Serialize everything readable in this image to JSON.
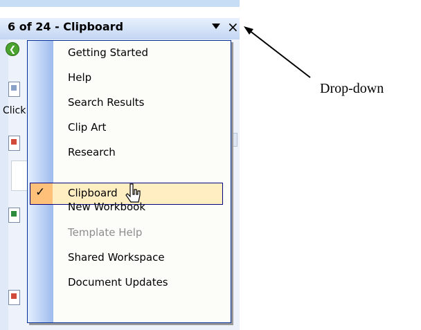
{
  "pane": {
    "title": "6 of 24 - Clipboard",
    "side_text": "Click"
  },
  "menu": {
    "items": [
      {
        "label": "Getting Started",
        "state": "normal"
      },
      {
        "label": "Help",
        "state": "normal"
      },
      {
        "label": "Search Results",
        "state": "normal"
      },
      {
        "label": "Clip Art",
        "state": "normal"
      },
      {
        "label": "Research",
        "state": "normal"
      },
      {
        "label": "Clipboard",
        "state": "selected"
      },
      {
        "label": "New Workbook",
        "state": "normal"
      },
      {
        "label": "Template Help",
        "state": "disabled"
      },
      {
        "label": "Shared Workspace",
        "state": "normal"
      },
      {
        "label": "Document Updates",
        "state": "normal"
      }
    ],
    "selected_check": "✓"
  },
  "annotation": {
    "label": "Drop-down"
  },
  "colors": {
    "menu_border": "#002d96",
    "selection_fill": "#ffeec2",
    "check_fill": "#ffc07a",
    "disabled_text": "#8d8d8d"
  }
}
